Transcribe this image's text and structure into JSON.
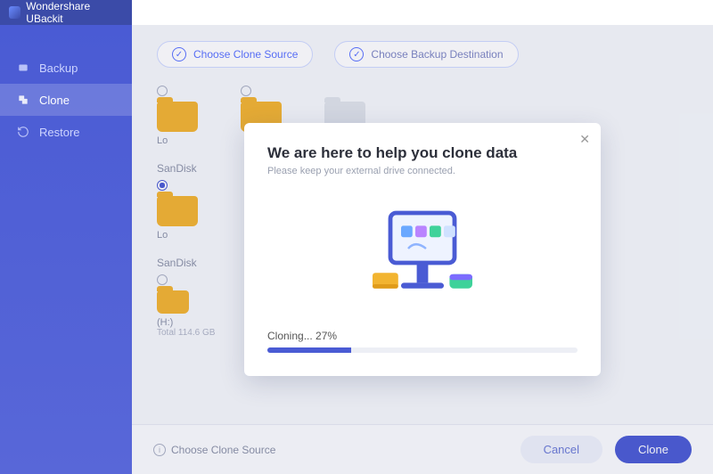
{
  "app_title": "Wondershare UBackit",
  "sidebar": {
    "items": [
      {
        "label": "Backup"
      },
      {
        "label": "Clone"
      },
      {
        "label": "Restore"
      }
    ]
  },
  "tabs": {
    "source": "Choose Clone Source",
    "destination": "Choose Backup Destination"
  },
  "sections": {
    "sandisk1": "SanDisk",
    "sandisk2": "SanDisk"
  },
  "drives": {
    "d0_name": "Lo",
    "d1_name": "",
    "d2_name": "Lo",
    "d3_name": "(H:)",
    "d3_sub": "Total 114.6 GB"
  },
  "footer": {
    "hint": "Choose Clone Source",
    "cancel": "Cancel",
    "clone": "Clone"
  },
  "modal": {
    "title": "We are here to help you clone data",
    "subtitle": "Please keep your external drive connected.",
    "progress_label": "Cloning... 27%",
    "progress_pct": 27
  }
}
